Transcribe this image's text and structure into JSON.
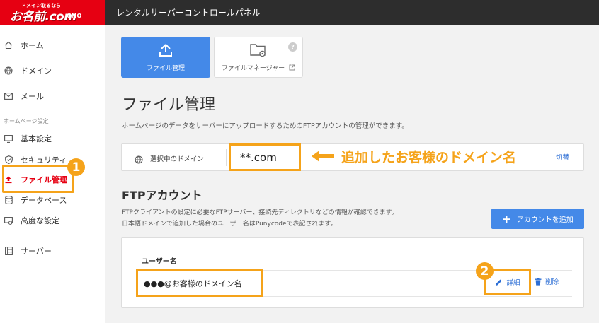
{
  "header": {
    "logo_small": "ドメイン取るなら",
    "logo_main": "お名前.com",
    "logo_gmo": "GMO",
    "app_title": "レンタルサーバーコントロールパネル"
  },
  "sidebar": {
    "items": [
      {
        "label": "ホーム",
        "icon": "home-icon"
      },
      {
        "label": "ドメイン",
        "icon": "globe-icon"
      },
      {
        "label": "メール",
        "icon": "mail-icon"
      }
    ],
    "section_label": "ホームページ設定",
    "section_items": [
      {
        "label": "基本設定",
        "icon": "monitor-icon"
      },
      {
        "label": "セキュリティ",
        "icon": "shield-icon"
      },
      {
        "label": "ファイル管理",
        "icon": "upload-icon",
        "active": true
      },
      {
        "label": "データベース",
        "icon": "database-icon"
      },
      {
        "label": "高度な設定",
        "icon": "advanced-settings-icon"
      }
    ],
    "server_item": {
      "label": "サーバー",
      "icon": "server-icon"
    }
  },
  "badges": {
    "one": "1",
    "two": "2"
  },
  "tabs": [
    {
      "label": "ファイル管理",
      "icon": "upload-icon",
      "active": true
    },
    {
      "label": "ファイルマネージャー",
      "icon": "folder-settings-icon",
      "help": "?"
    }
  ],
  "page": {
    "title": "ファイル管理",
    "description": "ホームページのデータをサーバーにアップロードするためのFTPアカウントの管理ができます。"
  },
  "domain": {
    "label": "選択中のドメイン",
    "value": "**.com",
    "annotation": "追加したお客様のドメイン名",
    "switch_label": "切替"
  },
  "ftp": {
    "title": "FTPアカウント",
    "desc_line1": "FTPクライアントの設定に必要なFTPサーバー、接続先ディレクトリなどの情報が確認できます。",
    "desc_line2": "日本語ドメインで追加した場合のユーザー名はPunycodeで表記されます。",
    "add_button": "アカウントを追加",
    "table": {
      "header_user": "ユーザー名",
      "rows": [
        {
          "user": "●●●@お客様のドメイン名",
          "detail": "詳細",
          "delete": "削除"
        }
      ]
    }
  },
  "colors": {
    "brand_red": "#e60012",
    "accent_blue": "#4489e8",
    "highlight_orange": "#f5a31a",
    "link_blue": "#2c6ed5"
  }
}
